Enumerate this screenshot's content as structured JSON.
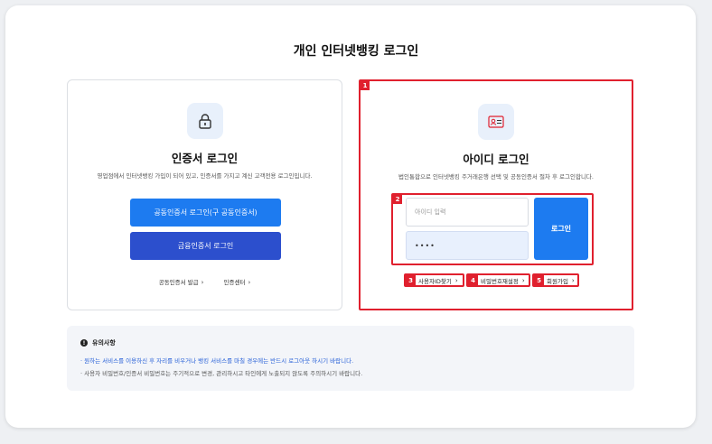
{
  "page": {
    "title": "개인 인터넷뱅킹 로그인"
  },
  "cert_login": {
    "title": "인증서 로그인",
    "description": "영업점에서 인터넷뱅킹 가입이 되어 있고, 인증서를 가지고 계신 고객전용 로그인입니다.",
    "public_cert_button": "공동인증서 로그인(구 공동인증서)",
    "financial_cert_button": "금융인증서 로그인",
    "links": [
      "공동인증서 발급",
      "인증센터"
    ],
    "icon": "lock-icon"
  },
  "id_login": {
    "badge": "1",
    "title": "아이디 로그인",
    "description": "법인통합으로 인터넷뱅킹 주거래은행 선택 및 공동인증서 절차 후 로그인합니다.",
    "form_badge": "2",
    "id_placeholder": "아이디 입력",
    "password_value": "••••",
    "login_button": "로그인",
    "icon": "id-card-icon",
    "sub_links": [
      {
        "num": "3",
        "label": "사용자ID찾기"
      },
      {
        "num": "4",
        "label": "비밀번호재설정"
      },
      {
        "num": "5",
        "label": "회원가입"
      }
    ]
  },
  "notice": {
    "title": "유의사항",
    "items": [
      "· 원하는 서비스를 이용하신 후 자리를 비우거나 뱅킹 서비스를 마칠 경우에는 반드시 로그아웃 하시기 바랍니다.",
      "· 사용자 비밀번호/인증서 비밀번호는 주기적으로 변경, 관리하시고 타인에게 노출되지 않도록 주의하시기 바랍니다."
    ]
  },
  "colors": {
    "primary_blue": "#1d7bf0",
    "secondary_blue": "#2c4fcd",
    "highlight_red": "#e0202e",
    "notice_link": "#2a62d8"
  }
}
